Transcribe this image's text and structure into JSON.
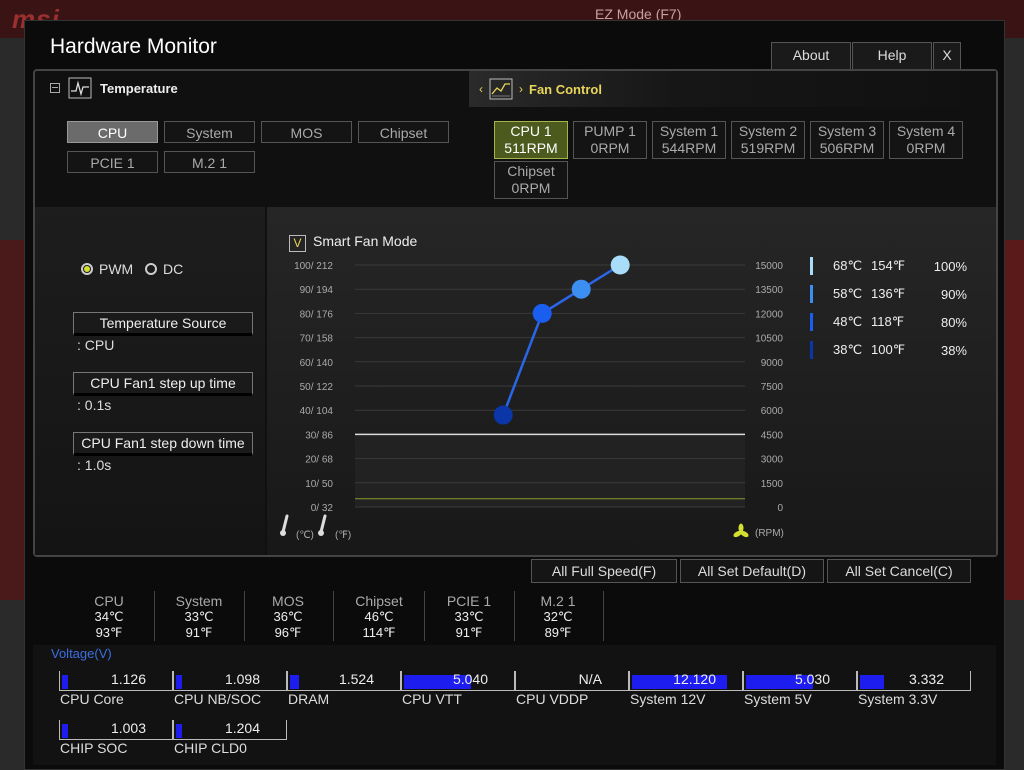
{
  "background": {
    "brand": "msi",
    "ez_mode": "EZ Mode (F7)"
  },
  "window": {
    "title": "Hardware Monitor",
    "about": "About",
    "help": "Help",
    "close": "X"
  },
  "sections": {
    "temperature": "Temperature",
    "fan_control": "Fan Control"
  },
  "temp_sources": [
    {
      "label": "CPU",
      "active": true
    },
    {
      "label": "System",
      "active": false
    },
    {
      "label": "MOS",
      "active": false
    },
    {
      "label": "Chipset",
      "active": false
    },
    {
      "label": "PCIE 1",
      "active": false
    },
    {
      "label": "M.2 1",
      "active": false
    }
  ],
  "fans": [
    {
      "name": "CPU 1",
      "rpm": "511RPM",
      "active": true
    },
    {
      "name": "PUMP 1",
      "rpm": "0RPM",
      "active": false
    },
    {
      "name": "System 1",
      "rpm": "544RPM",
      "active": false
    },
    {
      "name": "System 2",
      "rpm": "519RPM",
      "active": false
    },
    {
      "name": "System 3",
      "rpm": "506RPM",
      "active": false
    },
    {
      "name": "System 4",
      "rpm": "0RPM",
      "active": false
    },
    {
      "name": "Chipset",
      "rpm": "0RPM",
      "active": false
    }
  ],
  "mode": {
    "pwm": "PWM",
    "dc": "DC",
    "selected": "PWM"
  },
  "settings": {
    "temp_source_label": "Temperature Source",
    "temp_source_value": ": CPU",
    "step_up_label": "CPU Fan1 step up time",
    "step_up_value": ": 0.1s",
    "step_down_label": "CPU Fan1 step down time",
    "step_down_value": ": 1.0s"
  },
  "smart_fan": {
    "label": "Smart Fan Mode",
    "checked": true,
    "check_glyph": "V"
  },
  "chart_data": {
    "type": "line",
    "left_ticks": [
      "100/ 212",
      "90/ 194",
      "80/ 176",
      "70/ 158",
      "60/ 140",
      "50/ 122",
      "40/ 104",
      "30/  86",
      "20/  68",
      "10/  50",
      "0/  32"
    ],
    "right_ticks": [
      "15000",
      "13500",
      "12000",
      "10500",
      "9000",
      "7500",
      "6000",
      "4500",
      "3000",
      "1500",
      "0"
    ],
    "x_unit_c": "(℃)",
    "x_unit_f": "(℉)",
    "rpm_unit": "(RPM)",
    "points": [
      {
        "temp_c": 38,
        "percent": 38,
        "color": "#0b36a8"
      },
      {
        "temp_c": 48,
        "percent": 80,
        "color": "#1a5ef0"
      },
      {
        "temp_c": 58,
        "percent": 90,
        "color": "#3c8ef0"
      },
      {
        "temp_c": 68,
        "percent": 100,
        "color": "#a8dcf8"
      }
    ],
    "current_temp_c": 34,
    "current_rpm": 511,
    "ylim": [
      0,
      100
    ]
  },
  "legend": [
    {
      "c": "68℃",
      "f": "154℉",
      "pct": "100%",
      "color": "#a8dcf8"
    },
    {
      "c": "58℃",
      "f": "136℉",
      "pct": "90%",
      "color": "#3c8ef0"
    },
    {
      "c": "48℃",
      "f": "118℉",
      "pct": "80%",
      "color": "#1a5ef0"
    },
    {
      "c": "38℃",
      "f": "100℉",
      "pct": "38%",
      "color": "#0b36a8"
    }
  ],
  "actions": {
    "full_speed": "All Full Speed(F)",
    "set_default": "All Set Default(D)",
    "set_cancel": "All Set Cancel(C)"
  },
  "temps": [
    {
      "name": "CPU",
      "c": "34℃",
      "f": "93℉"
    },
    {
      "name": "System",
      "c": "33℃",
      "f": "91℉"
    },
    {
      "name": "MOS",
      "c": "36℃",
      "f": "96℉"
    },
    {
      "name": "Chipset",
      "c": "46℃",
      "f": "114℉"
    },
    {
      "name": "PCIE 1",
      "c": "33℃",
      "f": "91℉"
    },
    {
      "name": "M.2 1",
      "c": "32℃",
      "f": "89℉"
    }
  ],
  "voltage": {
    "title": "Voltage(V)",
    "items": [
      {
        "name": "CPU Core",
        "value": "1.126",
        "fill": 0.06
      },
      {
        "name": "CPU NB/SOC",
        "value": "1.098",
        "fill": 0.06
      },
      {
        "name": "DRAM",
        "value": "1.524",
        "fill": 0.08
      },
      {
        "name": "CPU VTT",
        "value": "5.040",
        "fill": 0.62
      },
      {
        "name": "CPU VDDP",
        "value": "N/A",
        "fill": 0
      },
      {
        "name": "System 12V",
        "value": "12.120",
        "fill": 0.88
      },
      {
        "name": "System 5V",
        "value": "5.030",
        "fill": 0.62
      },
      {
        "name": "System 3.3V",
        "value": "3.332",
        "fill": 0.22
      },
      {
        "name": "CHIP SOC",
        "value": "1.003",
        "fill": 0.06
      },
      {
        "name": "CHIP CLD0",
        "value": "1.204",
        "fill": 0.06
      }
    ]
  },
  "colors": {
    "accent": "#e8d65a",
    "active_fan": "#4d5a1e",
    "volt_bar": "#1d1df0",
    "curve": "#2a66e8"
  }
}
